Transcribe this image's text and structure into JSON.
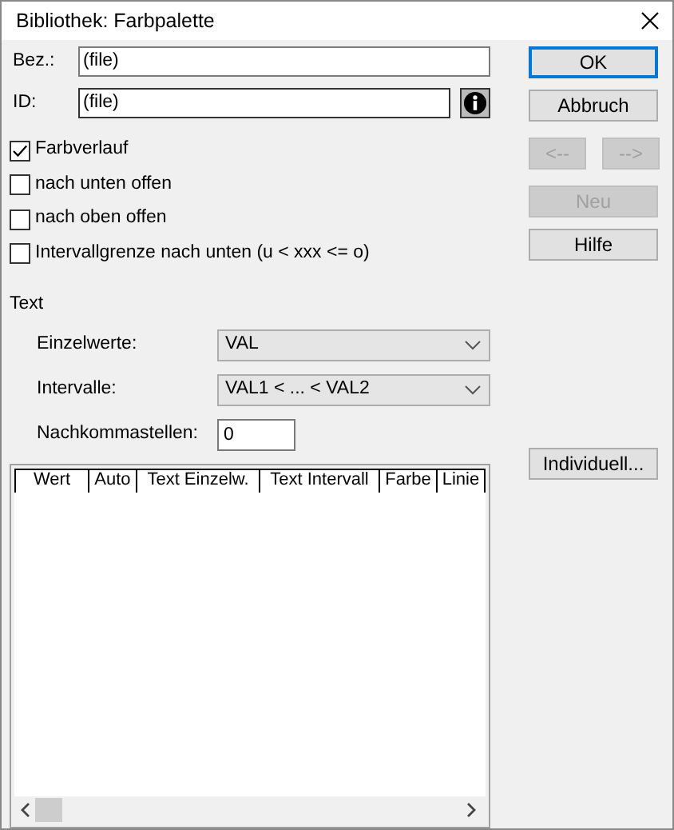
{
  "window": {
    "title": "Bibliothek: Farbpalette"
  },
  "fields": [
    {
      "label": "Bez.:",
      "value": "(file)",
      "info": false
    },
    {
      "label": "ID:",
      "value": "(file)",
      "info": true
    }
  ],
  "checkboxes": [
    {
      "label": "Farbverlauf",
      "checked": true
    },
    {
      "label": "nach unten offen",
      "checked": false
    },
    {
      "label": "nach oben offen",
      "checked": false
    },
    {
      "label": "Intervallgrenze nach unten (u < xxx <= o)",
      "checked": false
    }
  ],
  "section": "Text",
  "dropdowns": [
    {
      "label": "Einzelwerte:",
      "value": "VAL"
    },
    {
      "label": "Intervalle:",
      "value": "VAL1 < ... < VAL2"
    }
  ],
  "decimals": {
    "label": "Nachkommastellen:",
    "value": "0"
  },
  "table": {
    "columns": [
      "Wert",
      "Auto",
      "Text Einzelw.",
      "Text Intervall",
      "Farbe",
      "Linie"
    ]
  },
  "buttons": [
    {
      "label": "OK",
      "default": true,
      "disabled": false
    },
    {
      "label": "Abbruch",
      "default": false,
      "disabled": false
    },
    {
      "label": "<--",
      "default": false,
      "disabled": true,
      "pair": true
    },
    {
      "label": "-->",
      "default": false,
      "disabled": true,
      "pair": true
    },
    {
      "label": "Neu",
      "default": false,
      "disabled": true
    },
    {
      "label": "Hilfe",
      "default": false,
      "disabled": false
    }
  ],
  "side_button": {
    "label": "Individuell..."
  }
}
